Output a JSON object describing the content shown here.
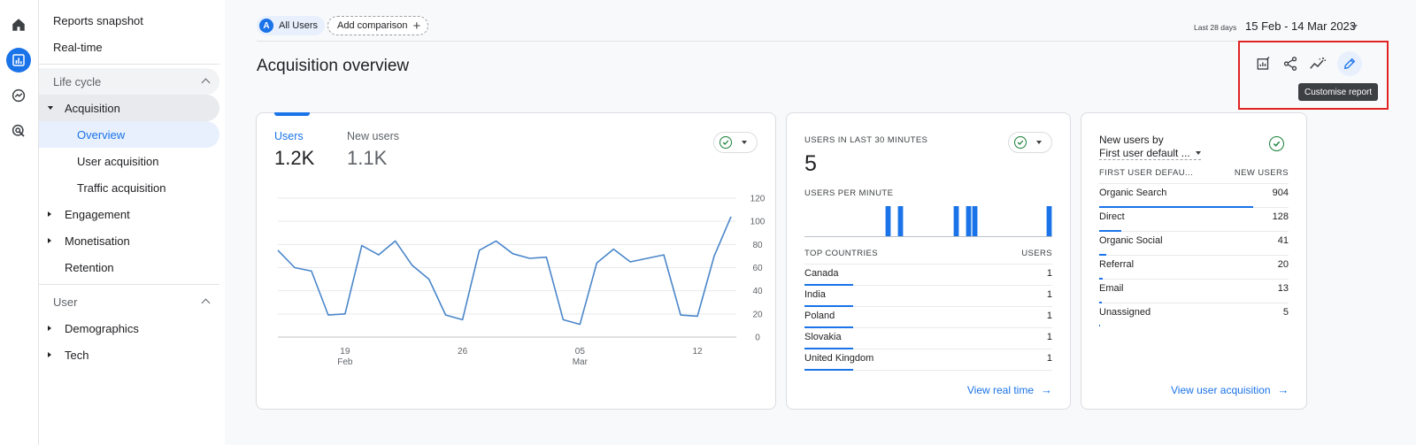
{
  "sidebar": {
    "reports_snapshot": "Reports snapshot",
    "realtime": "Real-time",
    "lifecycle": "Life cycle",
    "acquisition": "Acquisition",
    "overview": "Overview",
    "user_acquisition": "User acquisition",
    "traffic_acquisition": "Traffic acquisition",
    "engagement": "Engagement",
    "monetisation": "Monetisation",
    "retention": "Retention",
    "user": "User",
    "demographics": "Demographics",
    "tech": "Tech"
  },
  "header": {
    "segment_avatar": "A",
    "segment_label": "All Users",
    "add_comparison": "Add comparison",
    "date_hint": "Last 28 days",
    "date_range": "15 Feb - 14 Mar 2023",
    "page_title": "Acquisition overview",
    "tooltip": "Customise report"
  },
  "overview_card": {
    "tab1_label": "Users",
    "tab1_value": "1.2K",
    "tab2_label": "New users",
    "tab2_value": "1.1K"
  },
  "realtime_card": {
    "title": "USERS IN LAST 30 MINUTES",
    "value": "5",
    "per_minute_label": "USERS PER MINUTE",
    "col_countries": "TOP COUNTRIES",
    "col_users": "USERS",
    "rows": [
      {
        "name": "Canada",
        "value": "1"
      },
      {
        "name": "India",
        "value": "1"
      },
      {
        "name": "Poland",
        "value": "1"
      },
      {
        "name": "Slovakia",
        "value": "1"
      },
      {
        "name": "United Kingdom",
        "value": "1"
      }
    ],
    "per_minute_bars": [
      0,
      0,
      0,
      0,
      0,
      0,
      0,
      0,
      0,
      0,
      0,
      0,
      0,
      1,
      0,
      1,
      0,
      0,
      0,
      0,
      0,
      0,
      0,
      0,
      1,
      0,
      1,
      1,
      0,
      0,
      0,
      0,
      0,
      0,
      0,
      0,
      0,
      0,
      0,
      1
    ],
    "link": "View real time"
  },
  "new_users_card": {
    "title_line1": "New users by",
    "title_line2": "First user default ...",
    "col_channel": "FIRST USER DEFAU...",
    "col_users": "NEW USERS",
    "rows": [
      {
        "name": "Organic Search",
        "value": "904"
      },
      {
        "name": "Direct",
        "value": "128"
      },
      {
        "name": "Organic Social",
        "value": "41"
      },
      {
        "name": "Referral",
        "value": "20"
      },
      {
        "name": "Email",
        "value": "13"
      },
      {
        "name": "Unassigned",
        "value": "5"
      }
    ],
    "link": "View user acquisition"
  },
  "colors": {
    "accent": "#1a73e8",
    "success": "#188038",
    "highlight": "#e02424"
  },
  "chart_data": {
    "type": "line",
    "title": "",
    "xlabel": "",
    "ylabel": "",
    "ylim": [
      0,
      120
    ],
    "yticks": [
      0,
      20,
      40,
      60,
      80,
      100,
      120
    ],
    "x_ticks": [
      {
        "day": 19,
        "top": "19",
        "bottom": "Feb"
      },
      {
        "day": 26,
        "top": "26",
        "bottom": ""
      },
      {
        "day": 33,
        "top": "05",
        "bottom": "Mar"
      },
      {
        "day": 40,
        "top": "12",
        "bottom": ""
      }
    ],
    "x_start_day": 15,
    "series": [
      {
        "name": "Users",
        "color": "#4a86c9",
        "values": [
          75,
          60,
          57,
          19,
          20,
          79,
          71,
          83,
          62,
          50,
          19,
          15,
          75,
          83,
          72,
          68,
          69,
          15,
          11,
          64,
          76,
          65,
          68,
          71,
          19,
          18,
          70,
          104
        ]
      }
    ]
  }
}
